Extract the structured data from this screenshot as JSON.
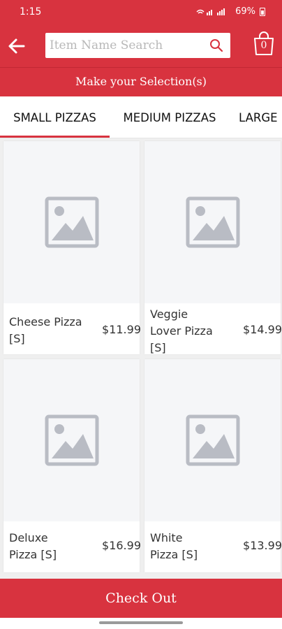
{
  "status_bar": {
    "time": "1:15",
    "battery": "69%"
  },
  "header": {
    "search_placeholder": "Item Name Search",
    "search_value": "",
    "cart_count": "0"
  },
  "banner": {
    "text": "Make your Selection(s)"
  },
  "tabs": [
    {
      "label": "SMALL PIZZAS",
      "active": true
    },
    {
      "label": "MEDIUM PIZZAS",
      "active": false
    },
    {
      "label": "LARGE",
      "active": false
    }
  ],
  "items": [
    {
      "name": "Cheese Pizza [S]",
      "price": "$11.99"
    },
    {
      "name": "Veggie Lover Pizza [S]",
      "price": "$14.99"
    },
    {
      "name": "Deluxe Pizza [S]",
      "price": "$16.99"
    },
    {
      "name": "White Pizza [S]",
      "price": "$13.99"
    }
  ],
  "checkout": {
    "label": "Check Out"
  },
  "colors": {
    "brand": "#d8333f",
    "placeholder_icon": "#b9bcc4",
    "text": "#333333"
  },
  "icons": {
    "back": "arrow-left-icon",
    "search": "search-icon",
    "cart": "shopping-bag-icon",
    "item_placeholder": "image-placeholder-icon"
  }
}
